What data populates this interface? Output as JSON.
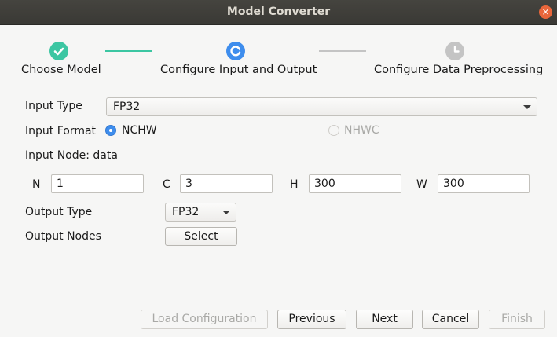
{
  "window": {
    "title": "Model Converter",
    "close_symbol": "×"
  },
  "steps": [
    {
      "label": "Choose Model",
      "state": "done",
      "color": "#3cc6a2"
    },
    {
      "label": "Configure Input and Output",
      "state": "active",
      "color": "#3e8ded"
    },
    {
      "label": "Configure Data Preprocessing",
      "state": "pending",
      "color": "#c4c4c4"
    }
  ],
  "form": {
    "input_type_label": "Input Type",
    "input_type_value": "FP32",
    "input_format_label": "Input Format",
    "format_options": [
      {
        "label": "NCHW",
        "selected": true,
        "enabled": true
      },
      {
        "label": "NHWC",
        "selected": false,
        "enabled": false
      }
    ],
    "input_node_label": "Input Node: data",
    "dims": [
      {
        "label": "N",
        "value": "1"
      },
      {
        "label": "C",
        "value": "3"
      },
      {
        "label": "H",
        "value": "300"
      },
      {
        "label": "W",
        "value": "300"
      }
    ],
    "output_type_label": "Output Type",
    "output_type_value": "FP32",
    "output_nodes_label": "Output Nodes",
    "select_label": "Select"
  },
  "buttons": {
    "load_configuration": {
      "label": "Load Configuration",
      "enabled": false
    },
    "previous": {
      "label": "Previous",
      "enabled": true
    },
    "next": {
      "label": "Next",
      "enabled": true
    },
    "cancel": {
      "label": "Cancel",
      "enabled": true
    },
    "finish": {
      "label": "Finish",
      "enabled": false
    }
  },
  "colors": {
    "accent": "#3e8ded",
    "done": "#3cc6a2",
    "pending": "#c4c4c4",
    "titlebar": "#3e3d39"
  }
}
